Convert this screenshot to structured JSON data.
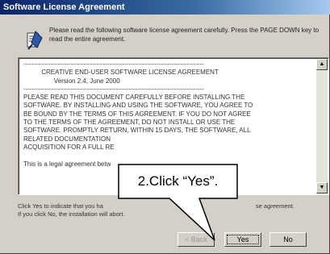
{
  "window": {
    "title": "Software License Agreement"
  },
  "header": {
    "icon": "license-agreement-icon",
    "instruction": "Please read the following software license agreement carefully. Press the PAGE DOWN key to read the entire agreement."
  },
  "license": {
    "heading_line1": "CREATIVE END-USER SOFTWARE LICENSE AGREEMENT",
    "heading_line2": "Version 2.4, June 2000",
    "body": [
      "PLEASE READ THIS DOCUMENT CAREFULLY BEFORE INSTALLING THE",
      "SOFTWARE. BY INSTALLING AND USING THE SOFTWARE, YOU AGREE TO",
      "BE BOUND BY THE TERMS OF THIS AGREEMENT. IF YOU DO NOT AGREE",
      "TO THE TERMS OF THE AGREEMENT, DO NOT INSTALL OR USE THE",
      "SOFTWARE. PROMPTLY RETURN, WITHIN 15 DAYS, THE SOFTWARE, ALL",
      "RELATED DOCUMENTATION",
      "ACQUISITION FOR A FULL RE"
    ],
    "footer_line": "This is a legal agreement betw"
  },
  "bottom_text": {
    "line1_start": "Click Yes to indicate that you ha",
    "line1_end": "se agreement.",
    "line2": "If you click No, the installation will abort."
  },
  "buttons": {
    "back": "< Back",
    "yes": "Yes",
    "no": "No"
  },
  "callout": {
    "text": "2.Click “Yes”."
  }
}
